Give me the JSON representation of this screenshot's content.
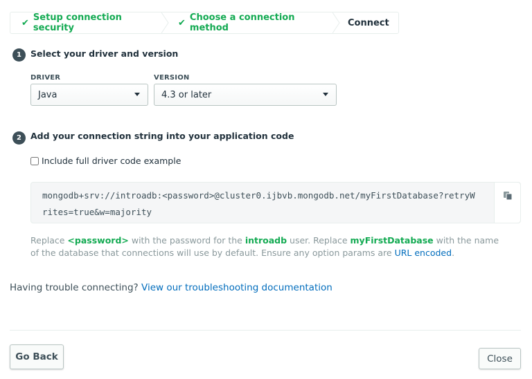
{
  "steps": [
    {
      "label": "Setup connection security",
      "status": "done"
    },
    {
      "label": "Choose a connection method",
      "status": "done"
    },
    {
      "label": "Connect",
      "status": "active"
    }
  ],
  "section1": {
    "number": "1",
    "title": "Select your driver and version"
  },
  "driver": {
    "label": "DRIVER",
    "value": "Java"
  },
  "version": {
    "label": "VERSION",
    "value": "4.3 or later"
  },
  "section2": {
    "number": "2",
    "title": "Add your connection string into your application code"
  },
  "include_example": {
    "label": "Include full driver code example",
    "checked": false
  },
  "connection_string": "mongodb+srv://introadb:<password>@cluster0.ijbvb.mongodb.net/myFirstDatabase?retryWrites=true&w=majority",
  "note": {
    "p1": "Replace ",
    "password": "<password>",
    "p2": " with the password for the ",
    "user": "introadb",
    "p3": " user. Replace ",
    "db": "myFirstDatabase",
    "p4": " with the name of the database that connections will use by default. Ensure any option params are ",
    "link": "URL encoded",
    "p5": "."
  },
  "trouble": {
    "text": "Having trouble connecting? ",
    "link": "View our troubleshooting documentation"
  },
  "buttons": {
    "back": "Go Back",
    "close": "Close"
  },
  "colors": {
    "accent_green": "#13aa52",
    "link_blue": "#006cbc"
  },
  "icons": {
    "check": "check-icon",
    "copy": "copy-icon",
    "caret": "caret-down-icon"
  }
}
